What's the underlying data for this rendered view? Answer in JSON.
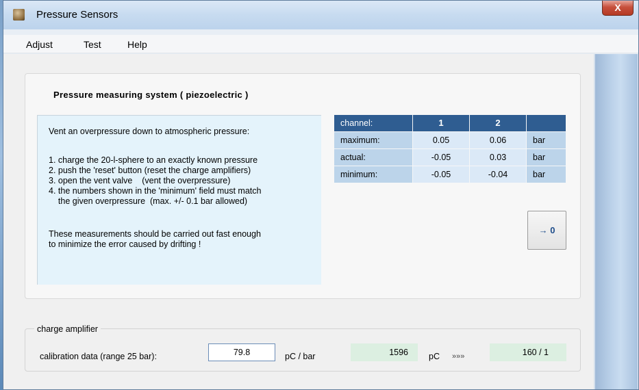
{
  "window": {
    "title": "Pressure  Sensors",
    "close_glyph": "X"
  },
  "menu": [
    "Adjust",
    "Test",
    "Help"
  ],
  "panel": {
    "heading": "Pressure  measuring  system   ( piezoelectric )",
    "instructions": [
      "Vent an overpressure down to atmospheric pressure:",
      "1. charge the 20-l-sphere to an exactly known pressure",
      "2. push the 'reset' button (reset the charge amplifiers)",
      "3. open the vent valve    (vent the overpressure)",
      "4. the numbers shown in the 'minimum' field must match",
      "    the given overpressure  (max. +/- 0.1 bar allowed)",
      "These measurements should be carried out fast enough",
      "to minimize the error caused by drifting !"
    ]
  },
  "table": {
    "header": [
      "channel:",
      "1",
      "2",
      ""
    ],
    "rows": [
      {
        "label": "maximum:",
        "ch1": "0.05",
        "ch2": "0.06",
        "unit": "bar"
      },
      {
        "label": "actual:",
        "ch1": "-0.05",
        "ch2": "0.03",
        "unit": "bar"
      },
      {
        "label": "minimum:",
        "ch1": "-0.05",
        "ch2": "-0.04",
        "unit": "bar"
      }
    ]
  },
  "zero_button": {
    "label": "→ 0"
  },
  "charge_amplifier": {
    "legend": "charge amplifier",
    "calibration_label": "calibration data  (range  25 bar):",
    "calibration_value": "79.8",
    "unit1": "pC / bar",
    "charge_value": "1596",
    "unit2": "pC",
    "arrows": "»»»",
    "ratio_value": "160 / 1"
  }
}
